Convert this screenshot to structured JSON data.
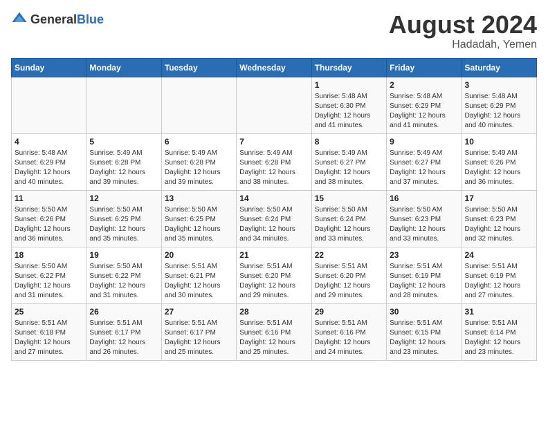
{
  "header": {
    "logo_general": "General",
    "logo_blue": "Blue",
    "main_title": "August 2024",
    "sub_title": "Hadadah, Yemen"
  },
  "days_of_week": [
    "Sunday",
    "Monday",
    "Tuesday",
    "Wednesday",
    "Thursday",
    "Friday",
    "Saturday"
  ],
  "weeks": [
    [
      {
        "day": "",
        "info": ""
      },
      {
        "day": "",
        "info": ""
      },
      {
        "day": "",
        "info": ""
      },
      {
        "day": "",
        "info": ""
      },
      {
        "day": "1",
        "info": "Sunrise: 5:48 AM\nSunset: 6:30 PM\nDaylight: 12 hours\nand 41 minutes."
      },
      {
        "day": "2",
        "info": "Sunrise: 5:48 AM\nSunset: 6:29 PM\nDaylight: 12 hours\nand 41 minutes."
      },
      {
        "day": "3",
        "info": "Sunrise: 5:48 AM\nSunset: 6:29 PM\nDaylight: 12 hours\nand 40 minutes."
      }
    ],
    [
      {
        "day": "4",
        "info": "Sunrise: 5:48 AM\nSunset: 6:29 PM\nDaylight: 12 hours\nand 40 minutes."
      },
      {
        "day": "5",
        "info": "Sunrise: 5:49 AM\nSunset: 6:28 PM\nDaylight: 12 hours\nand 39 minutes."
      },
      {
        "day": "6",
        "info": "Sunrise: 5:49 AM\nSunset: 6:28 PM\nDaylight: 12 hours\nand 39 minutes."
      },
      {
        "day": "7",
        "info": "Sunrise: 5:49 AM\nSunset: 6:28 PM\nDaylight: 12 hours\nand 38 minutes."
      },
      {
        "day": "8",
        "info": "Sunrise: 5:49 AM\nSunset: 6:27 PM\nDaylight: 12 hours\nand 38 minutes."
      },
      {
        "day": "9",
        "info": "Sunrise: 5:49 AM\nSunset: 6:27 PM\nDaylight: 12 hours\nand 37 minutes."
      },
      {
        "day": "10",
        "info": "Sunrise: 5:49 AM\nSunset: 6:26 PM\nDaylight: 12 hours\nand 36 minutes."
      }
    ],
    [
      {
        "day": "11",
        "info": "Sunrise: 5:50 AM\nSunset: 6:26 PM\nDaylight: 12 hours\nand 36 minutes."
      },
      {
        "day": "12",
        "info": "Sunrise: 5:50 AM\nSunset: 6:25 PM\nDaylight: 12 hours\nand 35 minutes."
      },
      {
        "day": "13",
        "info": "Sunrise: 5:50 AM\nSunset: 6:25 PM\nDaylight: 12 hours\nand 35 minutes."
      },
      {
        "day": "14",
        "info": "Sunrise: 5:50 AM\nSunset: 6:24 PM\nDaylight: 12 hours\nand 34 minutes."
      },
      {
        "day": "15",
        "info": "Sunrise: 5:50 AM\nSunset: 6:24 PM\nDaylight: 12 hours\nand 33 minutes."
      },
      {
        "day": "16",
        "info": "Sunrise: 5:50 AM\nSunset: 6:23 PM\nDaylight: 12 hours\nand 33 minutes."
      },
      {
        "day": "17",
        "info": "Sunrise: 5:50 AM\nSunset: 6:23 PM\nDaylight: 12 hours\nand 32 minutes."
      }
    ],
    [
      {
        "day": "18",
        "info": "Sunrise: 5:50 AM\nSunset: 6:22 PM\nDaylight: 12 hours\nand 31 minutes."
      },
      {
        "day": "19",
        "info": "Sunrise: 5:50 AM\nSunset: 6:22 PM\nDaylight: 12 hours\nand 31 minutes."
      },
      {
        "day": "20",
        "info": "Sunrise: 5:51 AM\nSunset: 6:21 PM\nDaylight: 12 hours\nand 30 minutes."
      },
      {
        "day": "21",
        "info": "Sunrise: 5:51 AM\nSunset: 6:20 PM\nDaylight: 12 hours\nand 29 minutes."
      },
      {
        "day": "22",
        "info": "Sunrise: 5:51 AM\nSunset: 6:20 PM\nDaylight: 12 hours\nand 29 minutes."
      },
      {
        "day": "23",
        "info": "Sunrise: 5:51 AM\nSunset: 6:19 PM\nDaylight: 12 hours\nand 28 minutes."
      },
      {
        "day": "24",
        "info": "Sunrise: 5:51 AM\nSunset: 6:19 PM\nDaylight: 12 hours\nand 27 minutes."
      }
    ],
    [
      {
        "day": "25",
        "info": "Sunrise: 5:51 AM\nSunset: 6:18 PM\nDaylight: 12 hours\nand 27 minutes."
      },
      {
        "day": "26",
        "info": "Sunrise: 5:51 AM\nSunset: 6:17 PM\nDaylight: 12 hours\nand 26 minutes."
      },
      {
        "day": "27",
        "info": "Sunrise: 5:51 AM\nSunset: 6:17 PM\nDaylight: 12 hours\nand 25 minutes."
      },
      {
        "day": "28",
        "info": "Sunrise: 5:51 AM\nSunset: 6:16 PM\nDaylight: 12 hours\nand 25 minutes."
      },
      {
        "day": "29",
        "info": "Sunrise: 5:51 AM\nSunset: 6:16 PM\nDaylight: 12 hours\nand 24 minutes."
      },
      {
        "day": "30",
        "info": "Sunrise: 5:51 AM\nSunset: 6:15 PM\nDaylight: 12 hours\nand 23 minutes."
      },
      {
        "day": "31",
        "info": "Sunrise: 5:51 AM\nSunset: 6:14 PM\nDaylight: 12 hours\nand 23 minutes."
      }
    ]
  ]
}
